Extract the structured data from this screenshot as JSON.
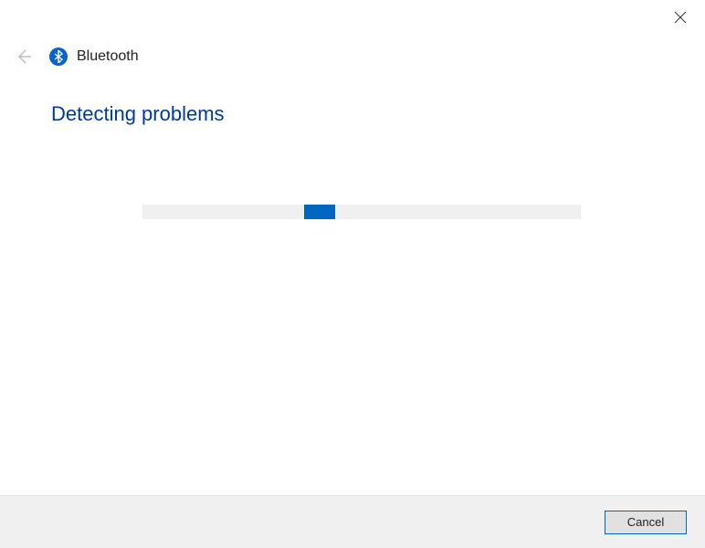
{
  "header": {
    "title": "Bluetooth"
  },
  "main": {
    "heading": "Detecting problems"
  },
  "footer": {
    "cancel_label": "Cancel"
  }
}
